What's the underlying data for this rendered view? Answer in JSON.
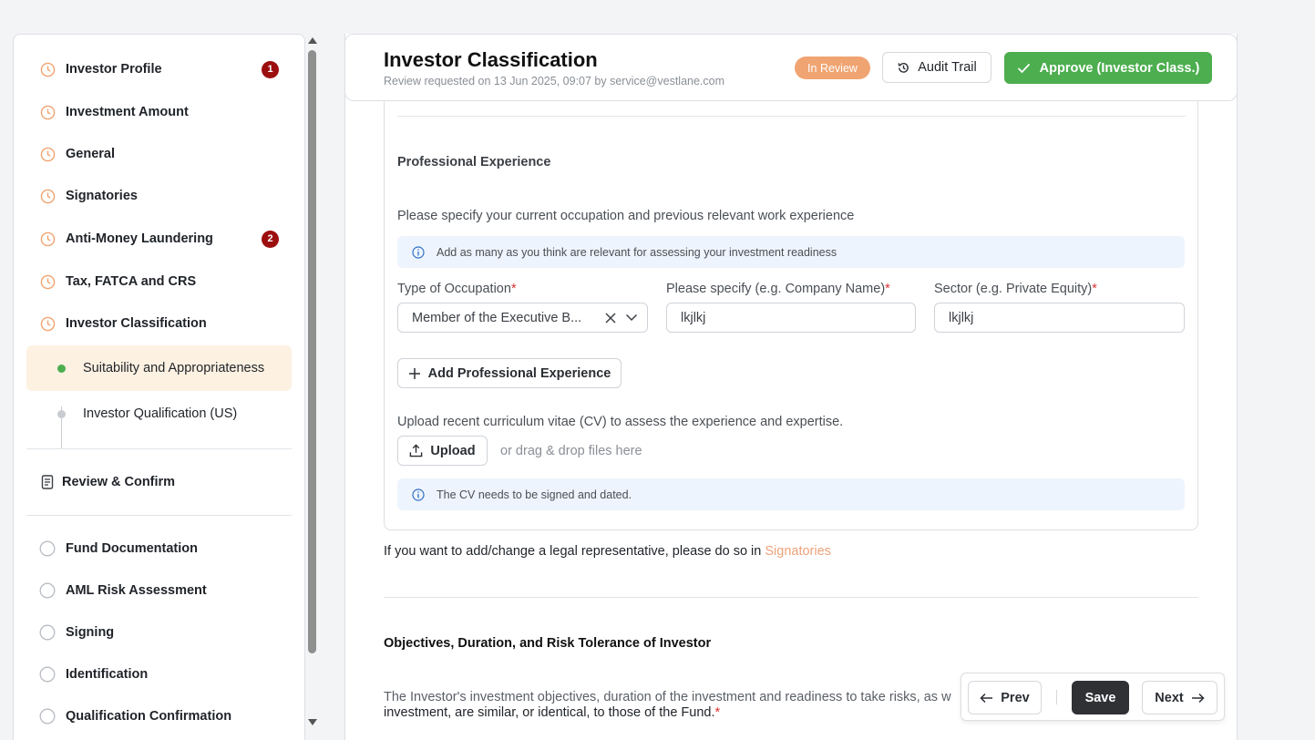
{
  "colors": {
    "accent_orange": "#f0a472",
    "approve_green": "#4cae4f",
    "badge_red": "#9c0f0f",
    "active_bg": "#fdf1e2",
    "info_bg": "#eef4fd"
  },
  "sidebar": {
    "steps": [
      {
        "label": "Investor Profile",
        "icon": "clock-icon",
        "badge": "1"
      },
      {
        "label": "Investment Amount",
        "icon": "clock-icon",
        "badge": null
      },
      {
        "label": "General",
        "icon": "clock-icon",
        "badge": null
      },
      {
        "label": "Signatories",
        "icon": "clock-icon",
        "badge": null
      },
      {
        "label": "Anti-Money Laundering",
        "icon": "clock-icon",
        "badge": "2"
      },
      {
        "label": "Tax, FATCA and CRS",
        "icon": "clock-icon",
        "badge": null
      },
      {
        "label": "Investor Classification",
        "icon": "clock-icon",
        "badge": null
      }
    ],
    "substeps": [
      {
        "label": "Suitability and Appropriateness",
        "active": true
      },
      {
        "label": "Investor Qualification (US)",
        "active": false
      }
    ],
    "review_label": "Review & Confirm",
    "later_steps": [
      {
        "label": "Fund Documentation",
        "icon": "empty-circle-icon"
      },
      {
        "label": "AML Risk Assessment",
        "icon": "empty-circle-icon"
      },
      {
        "label": "Signing",
        "icon": "empty-circle-icon"
      },
      {
        "label": "Identification",
        "icon": "empty-circle-icon"
      },
      {
        "label": "Qualification Confirmation",
        "icon": "empty-circle-icon"
      }
    ]
  },
  "header": {
    "title": "Investor Classification",
    "subtitle": "Review requested on 13 Jun 2025, 09:07 by service@vestlane.com",
    "status": "In Review",
    "audit_label": "Audit Trail",
    "approve_label": "Approve (Investor Class.)"
  },
  "professional": {
    "section_title": "Professional Experience",
    "prompt": "Please specify your current occupation and previous relevant work experience",
    "info": "Add as many as you think are relevant for assessing your investment readiness",
    "occupation_label": "Type of Occupation",
    "occupation_value": "Member of the Executive B...",
    "company_label": "Please specify (e.g. Company Name)",
    "company_value": "lkjlkj",
    "sector_label": "Sector (e.g. Private Equity)",
    "sector_value": "lkjlkj",
    "required_mark": "*",
    "add_label": "Add Professional Experience",
    "cv_prompt": "Upload recent curriculum vitae (CV) to assess the experience and expertise.",
    "upload_label": "Upload",
    "drag_hint": "or drag & drop files here",
    "cv_info": "The CV needs to be signed and dated."
  },
  "legal_rep": {
    "text": "If you want to add/change a legal representative, please do so in ",
    "link": "Signatories"
  },
  "objectives": {
    "title": "Objectives, Duration, and Risk Tolerance of Investor",
    "text_line1": "The Investor's investment objectives, duration of the investment and readiness to take risks, as w",
    "text_line2": "investment, are similar, or identical, to those of the Fund.",
    "required_mark": "*"
  },
  "nav": {
    "prev_label": "Prev",
    "save_label": "Save",
    "next_label": "Next"
  }
}
